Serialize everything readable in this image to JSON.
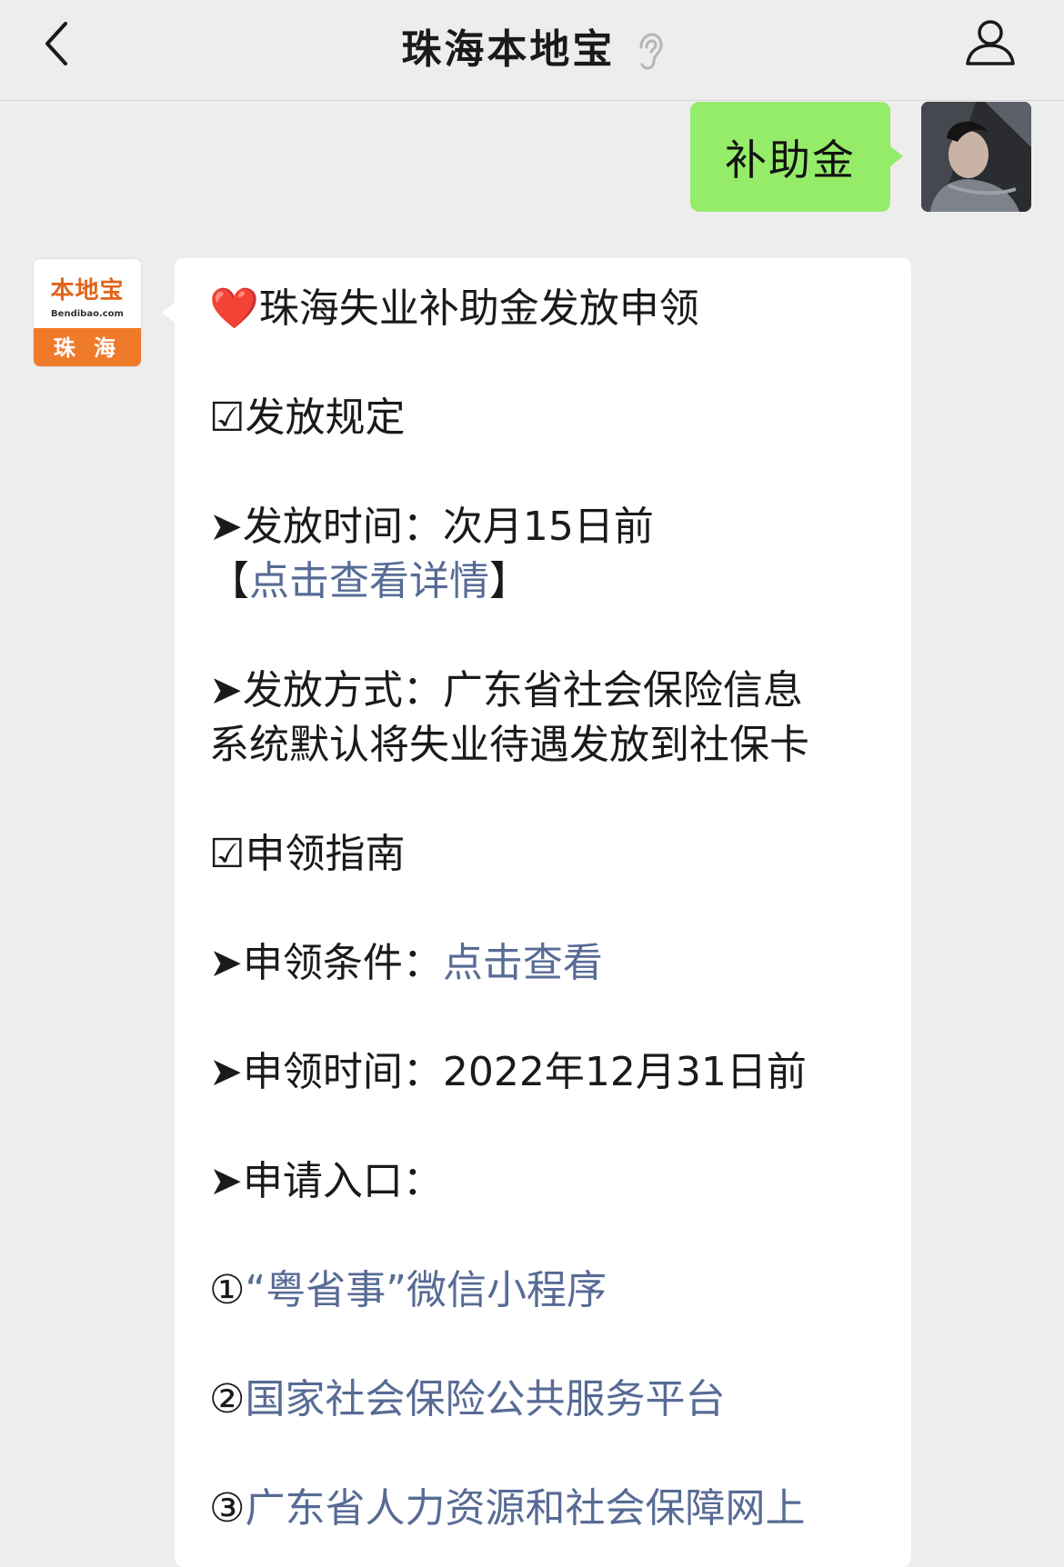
{
  "nav": {
    "title": "珠海本地宝"
  },
  "user_message": {
    "text": "补助金"
  },
  "bot": {
    "logo": {
      "cn": "本地宝",
      "en": "Bendibao.com",
      "city": "珠 海"
    },
    "message": {
      "heart": "❤️",
      "title": "珠海失业补助金发放申领",
      "section1": "☑发放规定",
      "time_label": "➤发放时间：次月15日前",
      "time_link_open": "【",
      "time_link": "点击查看详情",
      "time_link_close": "】",
      "method_line1": "➤发放方式：广东省社会保险信息",
      "method_line2": "系统默认将失业待遇发放到社保卡",
      "section2": "☑申领指南",
      "cond_label": "➤申领条件：",
      "cond_link": "点击查看",
      "apply_time": "➤申领时间：2022年12月31日前",
      "entry_label": "➤申请入口：",
      "entry1_num": "①",
      "entry1_link": "“粤省事”微信小程序",
      "entry2_num": "②",
      "entry2_link": "国家社会保险公共服务平台",
      "entry3_num": "③",
      "entry3_link": "广东省人力资源和社会保障网上"
    }
  },
  "colors": {
    "link": "#576b95",
    "user_bubble": "#95ec69",
    "background": "#ededed"
  }
}
